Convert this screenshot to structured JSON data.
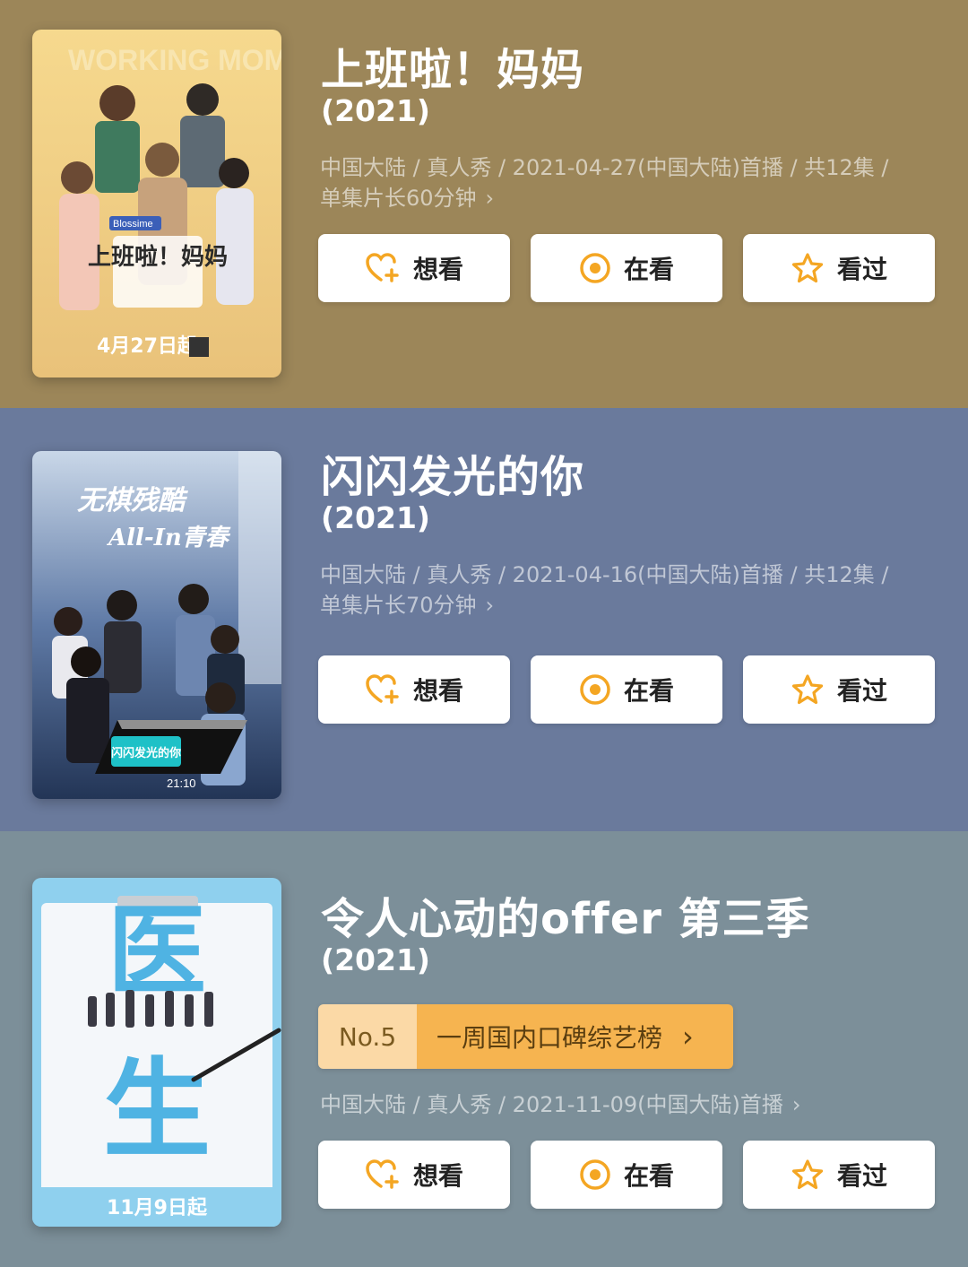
{
  "items": [
    {
      "title": "上班啦！妈妈",
      "year": "(2021)",
      "meta_line1": "中国大陆 / 真人秀 / 2021-04-27(中国大陆)首播 / 共12集 /",
      "meta_line2": "单集片长60分钟",
      "poster": {
        "top_text": "WORKING MOM",
        "logo_text": "上班啦！妈妈",
        "brand": "Blossime",
        "date_text": "4月27日起"
      }
    },
    {
      "title": "闪闪发光的你",
      "year": "(2021)",
      "meta_line1": "中国大陆 / 真人秀 / 2021-04-16(中国大陆)首播 / 共12集 /",
      "meta_line2": "单集片长70分钟",
      "poster": {
        "slogan_1": "无棋残酷",
        "slogan_2": "All-In青春",
        "logo_text": "闪闪发光的你",
        "time_text": "21:10"
      }
    },
    {
      "title": "令人心动的offer 第三季",
      "year": "(2021)",
      "rank": {
        "no": "No.5",
        "label": "一周国内口碑综艺榜"
      },
      "meta_line1": "中国大陆 / 真人秀 / 2021-11-09(中国大陆)首播",
      "poster": {
        "big_1": "医",
        "big_2": "生",
        "date_text": "11月9日起"
      }
    }
  ],
  "buttons": {
    "want": "想看",
    "watching": "在看",
    "watched": "看过"
  },
  "icons": {
    "chevron": "›",
    "want_icon": "heart-plus-icon",
    "watching_icon": "target-icon",
    "watched_icon": "star-icon"
  },
  "colors": {
    "card1": "#9c8659",
    "card2": "#6a7a9c",
    "card3": "#7c8f99",
    "accent": "#f4a623"
  }
}
